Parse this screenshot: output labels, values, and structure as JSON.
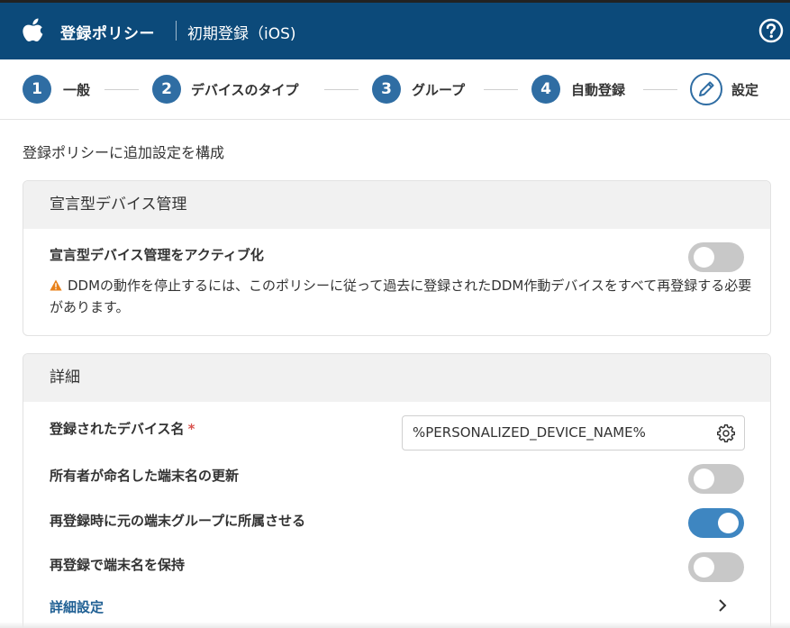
{
  "header": {
    "title": "登録ポリシー",
    "subtitle": "初期登録（iOS)",
    "apple_icon": "apple-logo-icon",
    "help_icon": "help-circle-icon"
  },
  "stepper": {
    "steps": [
      {
        "num": "1",
        "label": "一般"
      },
      {
        "num": "2",
        "label": "デバイスのタイプ"
      },
      {
        "num": "3",
        "label": "グループ"
      },
      {
        "num": "4",
        "label": "自動登録"
      },
      {
        "num": "",
        "label": "設定",
        "icon": "pencil-icon"
      }
    ]
  },
  "intro": "登録ポリシーに追加設定を構成",
  "ddm": {
    "title": "宣言型デバイス管理",
    "activate_label": "宣言型デバイス管理をアクティブ化",
    "activate_on": false,
    "warning": "DDMの動作を停止するには、このポリシーに従って過去に登録されたDDM作動デバイスをすべて再登録する必要があります。",
    "warning_icon": "warning-triangle-icon"
  },
  "details": {
    "title": "詳細",
    "device_name_label": "登録されたデバイス名",
    "required_mark": "*",
    "device_name_value": "%PERSONALIZED_DEVICE_NAME%",
    "owner_rename_label": "所有者が命名した端末名の更新",
    "owner_rename_on": false,
    "reenroll_group_label": "再登録時に元の端末グループに所属させる",
    "reenroll_group_on": true,
    "keep_name_label": "再登録で端末名を保持",
    "keep_name_on": false,
    "advanced_link": "詳細設定"
  },
  "colors": {
    "header_bg": "#0c4a7a",
    "step_circle": "#2f6da3",
    "toggle_on": "#3e86c1",
    "toggle_off": "#c8c8c8",
    "warning": "#e8811a",
    "required": "#d9534f",
    "link": "#1f5f93"
  }
}
